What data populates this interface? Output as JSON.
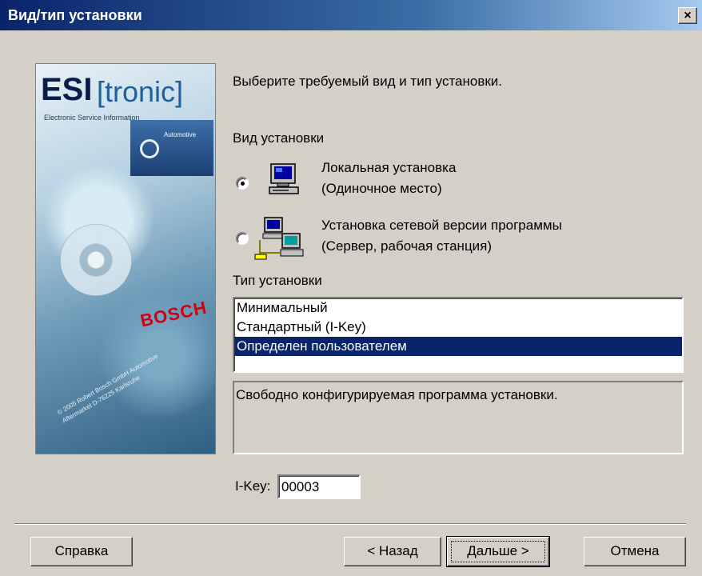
{
  "window": {
    "title": "Вид/тип установки",
    "close_glyph": "×"
  },
  "side_image": {
    "logo_main": "ESI",
    "logo_sub": "[tronic]",
    "logo_caption": "Electronic Service Information",
    "badge_label": "Automotive",
    "brand": "BOSCH",
    "copyright": "© 2005 Robert Bosch GmbH Automotive Aftermarket D-76225 Karlsruhe"
  },
  "intro": "Выберите требуемый вид и тип установки.",
  "install_kind": {
    "heading": "Вид установки",
    "options": [
      {
        "line1": "Локальная установка",
        "line2": "(Одиночное место)",
        "selected": true,
        "icon": "computer-icon"
      },
      {
        "line1": "Установка сетевой версии программы",
        "line2": "(Сервер, рабочая станция)",
        "selected": false,
        "icon": "network-icon"
      }
    ]
  },
  "install_type": {
    "heading": "Тип установки",
    "items": [
      "Минимальный",
      "Стандартный (I-Key)",
      "Определен пользователем"
    ],
    "selected_index": 2
  },
  "description": "Свободно конфигурируемая программа установки.",
  "ikey": {
    "label": "I-Key:",
    "value": "00003"
  },
  "buttons": {
    "help": "Справка",
    "back": "< Назад",
    "next": "Дальше >",
    "cancel": "Отмена"
  },
  "colors": {
    "title_start": "#0a246a",
    "selection": "#0a246a",
    "face": "#d4d0c8"
  }
}
